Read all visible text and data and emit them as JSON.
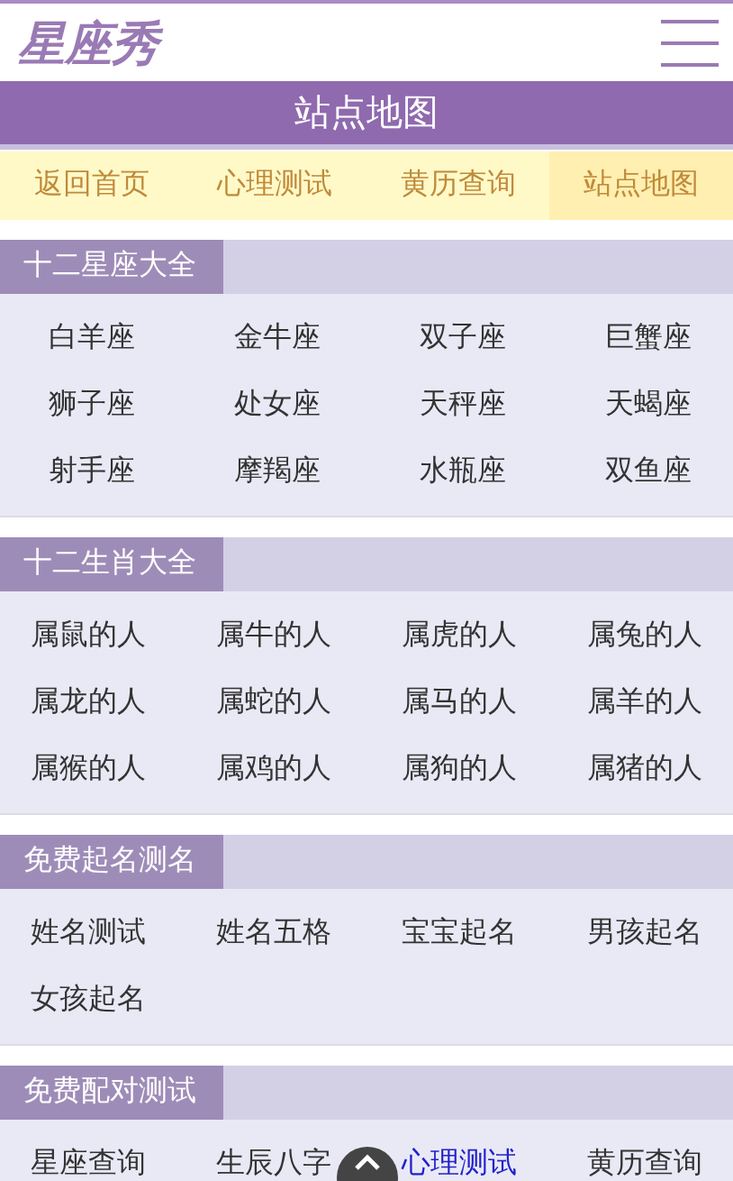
{
  "header": {
    "logo": "星座秀"
  },
  "title_bar": {
    "title": "站点地图"
  },
  "nav": [
    {
      "label": "返回首页",
      "selected": false
    },
    {
      "label": "心理测试",
      "selected": false
    },
    {
      "label": "黄历查询",
      "selected": false
    },
    {
      "label": "站点地图",
      "selected": true
    }
  ],
  "sections": [
    {
      "title": "十二星座大全",
      "items": [
        {
          "label": "白羊座",
          "visited": false
        },
        {
          "label": "金牛座",
          "visited": false
        },
        {
          "label": "双子座",
          "visited": false
        },
        {
          "label": "巨蟹座",
          "visited": false
        },
        {
          "label": "狮子座",
          "visited": false
        },
        {
          "label": "处女座",
          "visited": false
        },
        {
          "label": "天秤座",
          "visited": false
        },
        {
          "label": "天蝎座",
          "visited": false
        },
        {
          "label": "射手座",
          "visited": false
        },
        {
          "label": "摩羯座",
          "visited": false
        },
        {
          "label": "水瓶座",
          "visited": false
        },
        {
          "label": "双鱼座",
          "visited": false
        }
      ]
    },
    {
      "title": "十二生肖大全",
      "items": [
        {
          "label": "属鼠的人",
          "visited": false
        },
        {
          "label": "属牛的人",
          "visited": false
        },
        {
          "label": "属虎的人",
          "visited": false
        },
        {
          "label": "属兔的人",
          "visited": false
        },
        {
          "label": "属龙的人",
          "visited": false
        },
        {
          "label": "属蛇的人",
          "visited": false
        },
        {
          "label": "属马的人",
          "visited": false
        },
        {
          "label": "属羊的人",
          "visited": false
        },
        {
          "label": "属猴的人",
          "visited": false
        },
        {
          "label": "属鸡的人",
          "visited": false
        },
        {
          "label": "属狗的人",
          "visited": false
        },
        {
          "label": "属猪的人",
          "visited": false
        }
      ]
    },
    {
      "title": "免费起名测名",
      "items": [
        {
          "label": "姓名测试",
          "visited": false
        },
        {
          "label": "姓名五格",
          "visited": false
        },
        {
          "label": "宝宝起名",
          "visited": false
        },
        {
          "label": "男孩起名",
          "visited": false
        },
        {
          "label": "女孩起名",
          "visited": false
        }
      ]
    },
    {
      "title": "免费配对测试",
      "items": [
        {
          "label": "星座查询",
          "visited": false
        },
        {
          "label": "生辰八字",
          "visited": false
        },
        {
          "label": "心理测试",
          "visited": true
        },
        {
          "label": "黄历查询",
          "visited": false
        }
      ]
    }
  ]
}
